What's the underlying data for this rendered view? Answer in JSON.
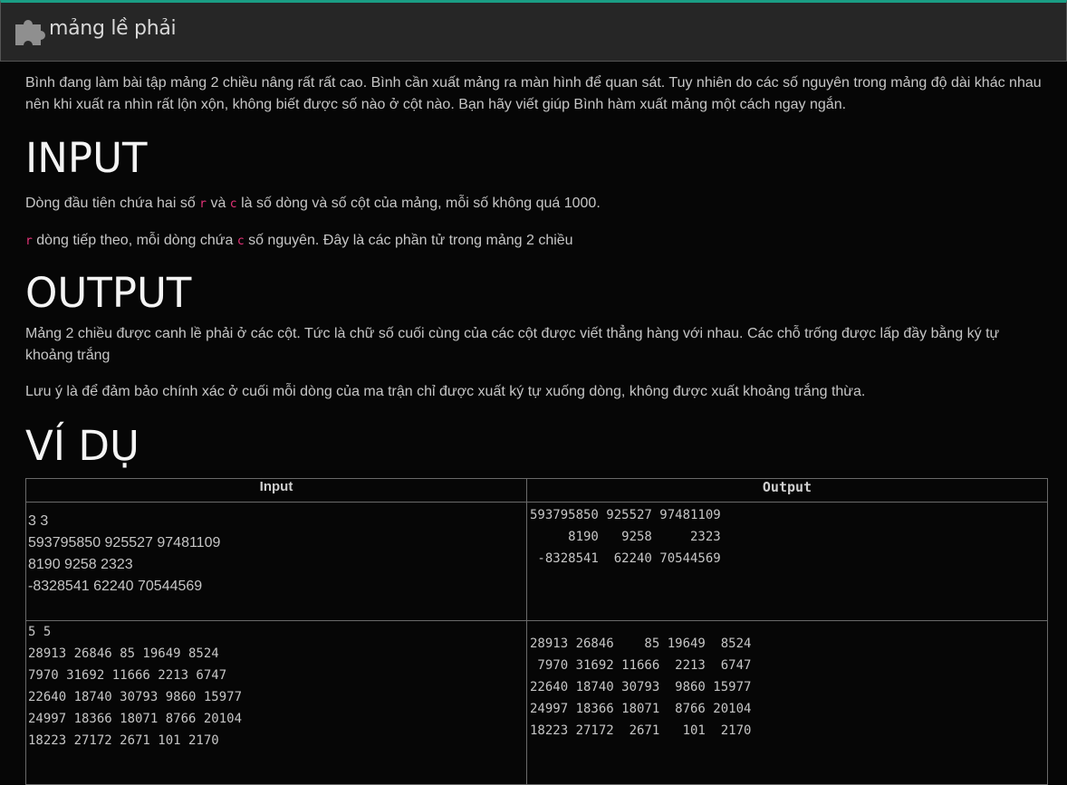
{
  "header": {
    "title": "mảng lề phải",
    "icon": "puzzle-piece-icon",
    "accent_color": "#1a9d84"
  },
  "problem": {
    "statement": "Bình đang làm bài tập mảng 2 chiều nâng rất rất cao. Bình cần xuất mảng ra màn hình để quan sát. Tuy nhiên do các số nguyên trong mảng độ dài khác nhau nên khi xuất ra nhìn rất lộn xộn, không biết được số nào ở cột nào. Bạn hãy viết giúp Bình hàm xuất mảng một cách ngay ngắn.",
    "input_heading": "INPUT",
    "input_line1": {
      "part1": "Dòng đầu tiên chứa hai số ",
      "var_r": "r",
      "part2": " và ",
      "var_c": "c",
      "part3": " là số dòng và số cột của mảng, mỗi số không quá 1000."
    },
    "input_line2": {
      "var_r": "r",
      "part1": " dòng tiếp theo, mỗi dòng chứa ",
      "var_c": "c",
      "part2": " số nguyên. Đây là các phần tử trong mảng 2 chiều"
    },
    "output_heading": "OUTPUT",
    "output_para1": "Mảng 2 chiều được canh lề phải ở các cột. Tức là chữ số cuối cùng của các cột được viết thẳng hàng với nhau. Các chỗ trống được lấp đầy bằng ký tự khoảng trắng",
    "output_para2": "Lưu ý là để đảm bảo chính xác ở cuối mỗi dòng của ma trận chỉ được xuất ký tự xuống dòng, không được xuất khoảng trắng thừa.",
    "examples_heading": "VÍ DỤ"
  },
  "examples": {
    "headers": {
      "input": "Input",
      "output": "Output"
    },
    "rows": [
      {
        "input": "3 3\n593795850 925527 97481109\n8190 9258 2323\n-8328541 62240 70544569",
        "output": "593795850 925527 97481109\n     8190   9258     2323\n -8328541  62240 70544569"
      },
      {
        "input": "5 5\n28913 26846 85 19649 8524\n7970 31692 11666 2213 6747\n22640 18740 30793 9860 15977\n24997 18366 18071 8766 20104\n18223 27172 2671 101 2170",
        "output": "28913 26846    85 19649  8524\n 7970 31692 11666  2213  6747\n22640 18740 30793  9860 15977\n24997 18366 18071  8766 20104\n18223 27172  2671   101  2170"
      }
    ]
  }
}
